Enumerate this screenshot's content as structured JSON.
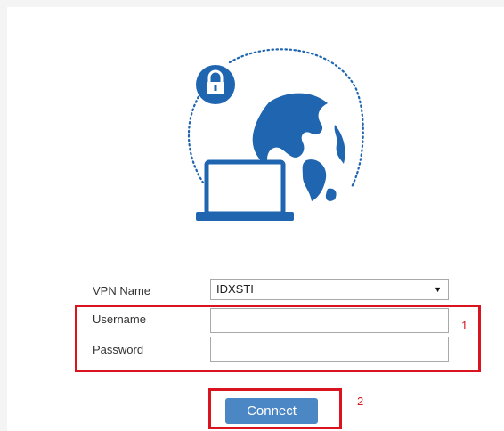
{
  "form": {
    "vpn_name_label": "VPN Name",
    "vpn_name_value": "IDXSTI",
    "username_label": "Username",
    "username_value": "",
    "password_label": "Password",
    "password_value": ""
  },
  "actions": {
    "connect_label": "Connect"
  },
  "annotations": {
    "box1_number": "1",
    "box2_number": "2"
  },
  "icons": {
    "illustration": "vpn-lock-laptop-globe-icon",
    "select_arrow": "dropdown-arrow-icon"
  },
  "colors": {
    "brand_blue": "#1f65b0",
    "button_blue": "#4a87c4",
    "annotation_red": "#d9141e"
  }
}
